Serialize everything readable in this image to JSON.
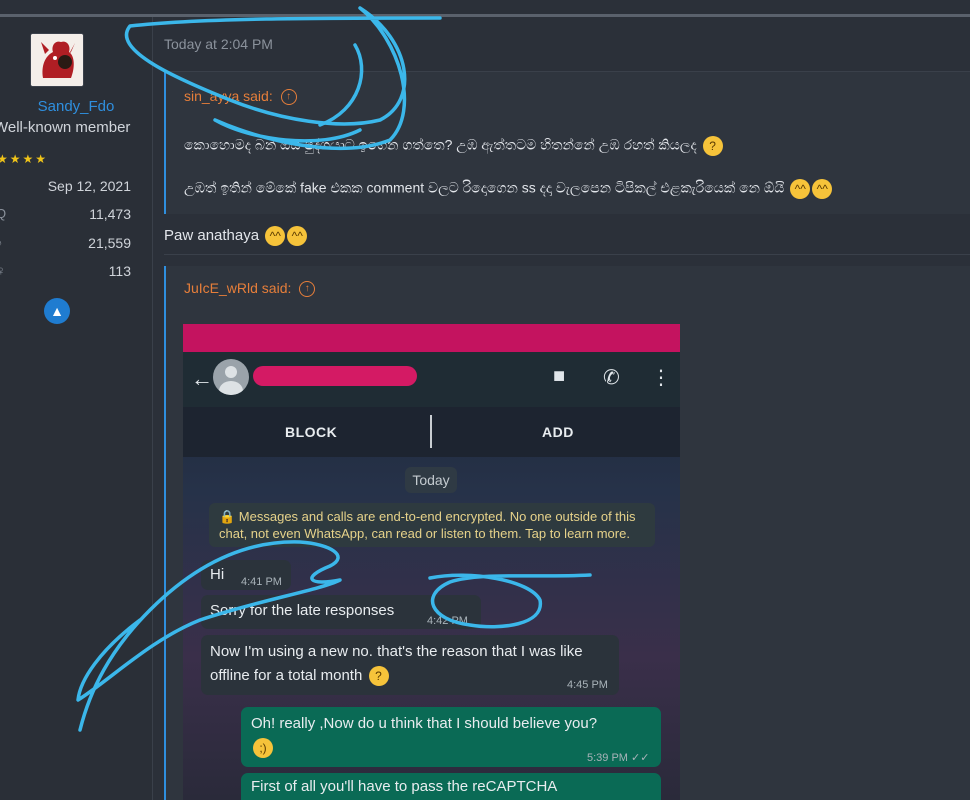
{
  "sidebar": {
    "username": "Sandy_Fdo",
    "user_title": "Well-known member",
    "stars": "★★★★",
    "joined": "Sep 12, 2021",
    "stats": [
      {
        "icon": "message-icon",
        "label": "Q",
        "value": "11,473"
      },
      {
        "icon": "like-icon",
        "label": "♪",
        "value": "21,559"
      },
      {
        "icon": "trophy-icon",
        "label": "♀",
        "value": "113"
      }
    ]
  },
  "post": {
    "time": "Today at 2:04 PM",
    "quote1": {
      "author": "sin_ayya said:",
      "line1": "කොහොමද බන් ඔය පුද්ගයාට ඉගෙන ගත්තෙ? උඹ ඇත්තටම හිතන්නේ උඹ රහත් කියලද",
      "line2": "උඹත් ඉතින් මේකේ fake එකක comment වලට රිදොගෙන ss දදා වැලපෙන ටිපිකල් එළකැරියෙක් නෙ ඕයි"
    },
    "reply": "Paw anathaya",
    "quote2": {
      "author": "JuIcE_wRld said:"
    }
  },
  "whatsapp": {
    "actions": {
      "block": "BLOCK",
      "add": "ADD"
    },
    "date_chip": "Today",
    "encryption_notice": "🔒 Messages and calls are end-to-end encrypted. No one outside of this chat, not even WhatsApp, can read or listen to them. Tap to learn more.",
    "messages": [
      {
        "dir": "in",
        "text": "Hi",
        "time": "4:41 PM"
      },
      {
        "dir": "in",
        "text": "Sorry for the late responses",
        "time": "4:42 PM"
      },
      {
        "dir": "in",
        "text": "Now I'm using a new no. that's the reason that I was like offline for a total month",
        "time": "4:45 PM"
      },
      {
        "dir": "out",
        "text": "Oh! really ,Now do u think that I should believe you?",
        "time": "5:39 PM"
      },
      {
        "dir": "out",
        "text": "First of all you'll have to pass the reCAPTCHA",
        "time": ""
      }
    ]
  },
  "colors": {
    "accent": "#2f8fde",
    "quote_author": "#e67e3a",
    "redaction": "#d41a64",
    "scribble": "#3bb7ea"
  }
}
